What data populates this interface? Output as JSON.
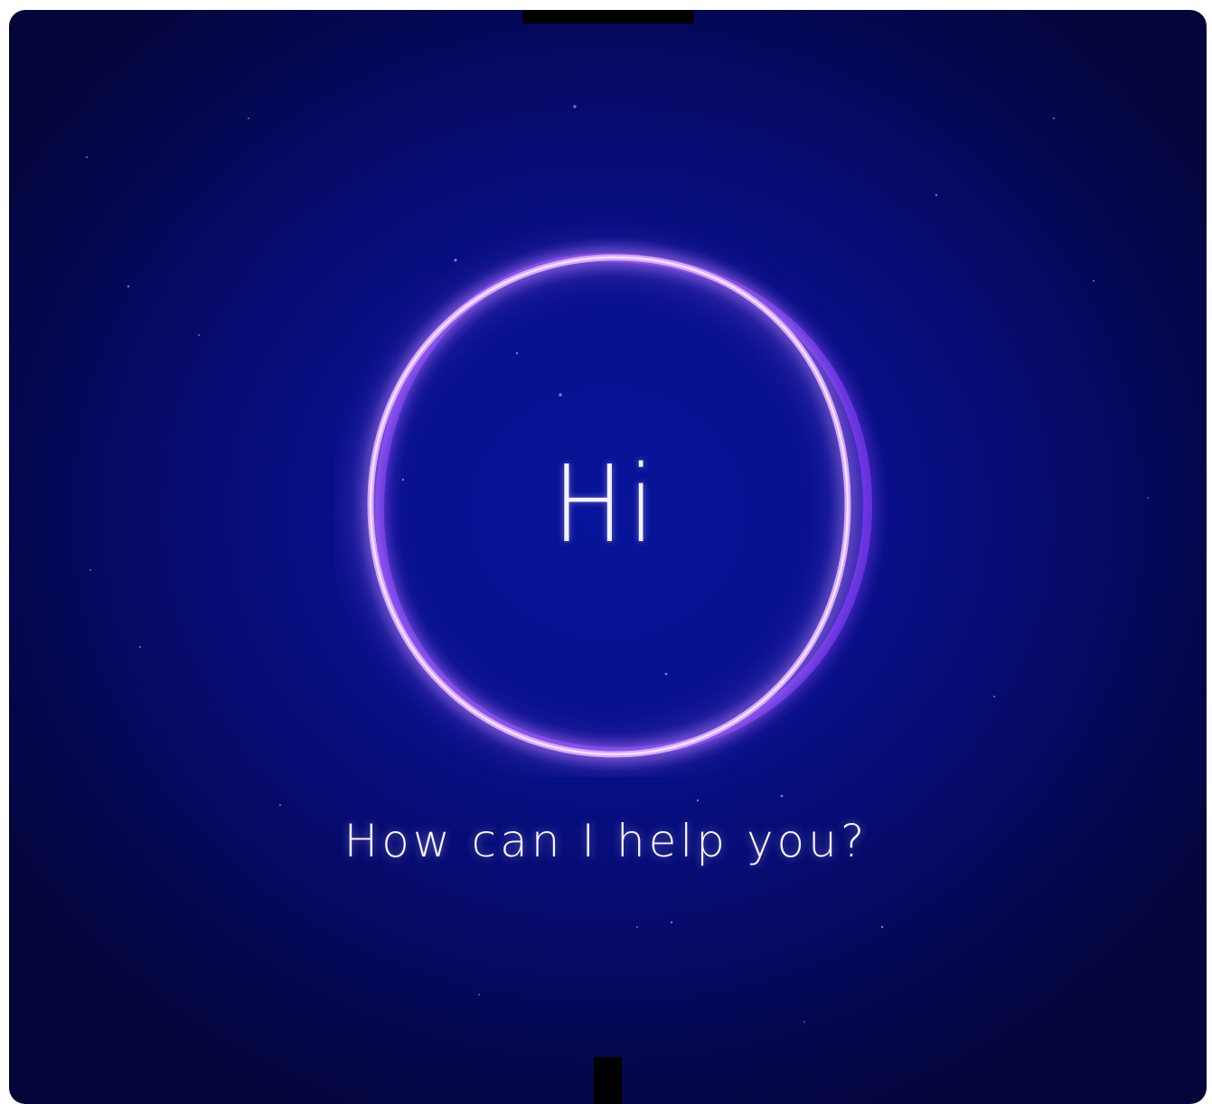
{
  "assistant": {
    "greeting": "Hi",
    "prompt": "How can I help you?"
  },
  "colors": {
    "background_center": "#08149a",
    "background_edge": "#05053a",
    "ring": "#c58bff",
    "text": "#f4f2ff"
  },
  "icons": {
    "orb": "voice-assistant-ring-icon"
  }
}
